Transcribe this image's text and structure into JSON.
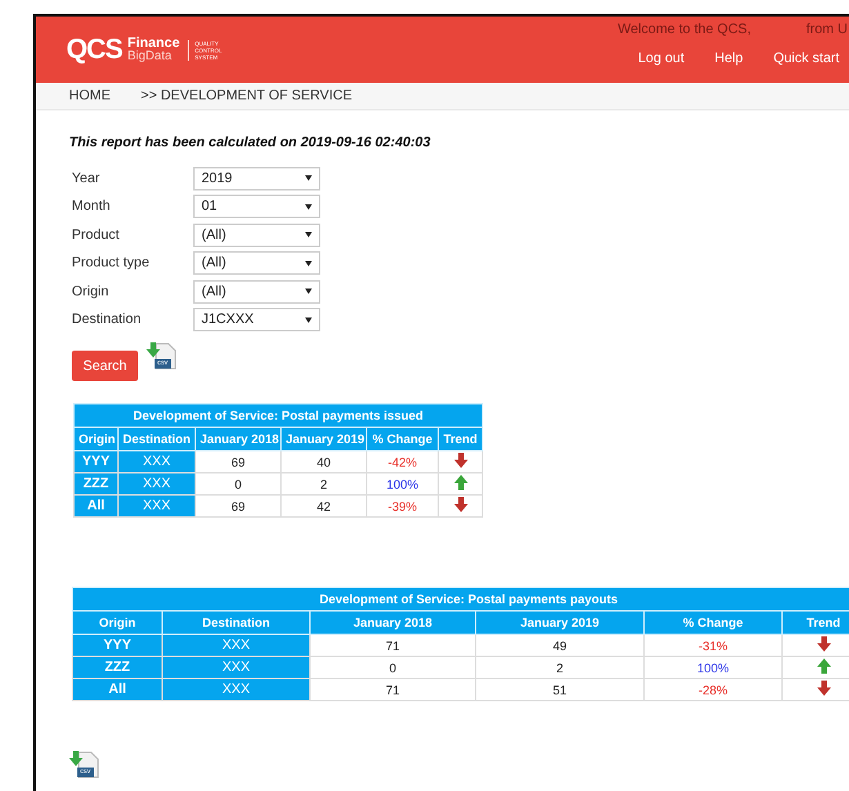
{
  "header": {
    "logo": {
      "main": "QCS",
      "product": "Finance",
      "sub": "BigData",
      "tagline": [
        "QUALITY",
        "CONTROL",
        "SYSTEM"
      ]
    },
    "welcome": "Welcome to the QCS,",
    "welcome_cut": "from U",
    "links": [
      "Log out",
      "Help",
      "Quick start"
    ]
  },
  "breadcrumb": [
    "HOME",
    ">> DEVELOPMENT OF SERVICE"
  ],
  "report_note": "This report has been calculated on 2019-09-16 02:40:03",
  "filters": [
    {
      "label": "Year",
      "value": "2019"
    },
    {
      "label": "Month",
      "value": "01"
    },
    {
      "label": "Product",
      "value": "(All)"
    },
    {
      "label": "Product type",
      "value": "(All)"
    },
    {
      "label": "Origin",
      "value": "(All)"
    },
    {
      "label": "Destination",
      "value": "J1CXXX"
    }
  ],
  "search_button": "Search",
  "export_label": "csv",
  "tables": [
    {
      "title": "Development of Service: Postal payments issued",
      "columns": [
        "Origin",
        "Destination",
        "January 2018",
        "January 2019",
        "% Change",
        "Trend"
      ],
      "rows": [
        {
          "origin": "YYY",
          "destination": "XXX",
          "prev": "69",
          "curr": "40",
          "change": "-42%",
          "trend_up": false
        },
        {
          "origin": "ZZZ",
          "destination": "XXX",
          "prev": "0",
          "curr": "2",
          "change": "100%",
          "trend_up": true
        },
        {
          "origin": "All",
          "destination": "XXX",
          "prev": "69",
          "curr": "42",
          "change": "-39%",
          "trend_up": false
        }
      ]
    },
    {
      "title": "Development of Service: Postal payments payouts",
      "columns": [
        "Origin",
        "Destination",
        "January 2018",
        "January 2019",
        "% Change",
        "Trend"
      ],
      "rows": [
        {
          "origin": "YYY",
          "destination": "XXX",
          "prev": "71",
          "curr": "49",
          "change": "-31%",
          "trend_up": false
        },
        {
          "origin": "ZZZ",
          "destination": "XXX",
          "prev": "0",
          "curr": "2",
          "change": "100%",
          "trend_up": true
        },
        {
          "origin": "All",
          "destination": "XXX",
          "prev": "71",
          "curr": "51",
          "change": "-28%",
          "trend_up": false
        }
      ]
    }
  ],
  "export_label_bottom": "csv"
}
